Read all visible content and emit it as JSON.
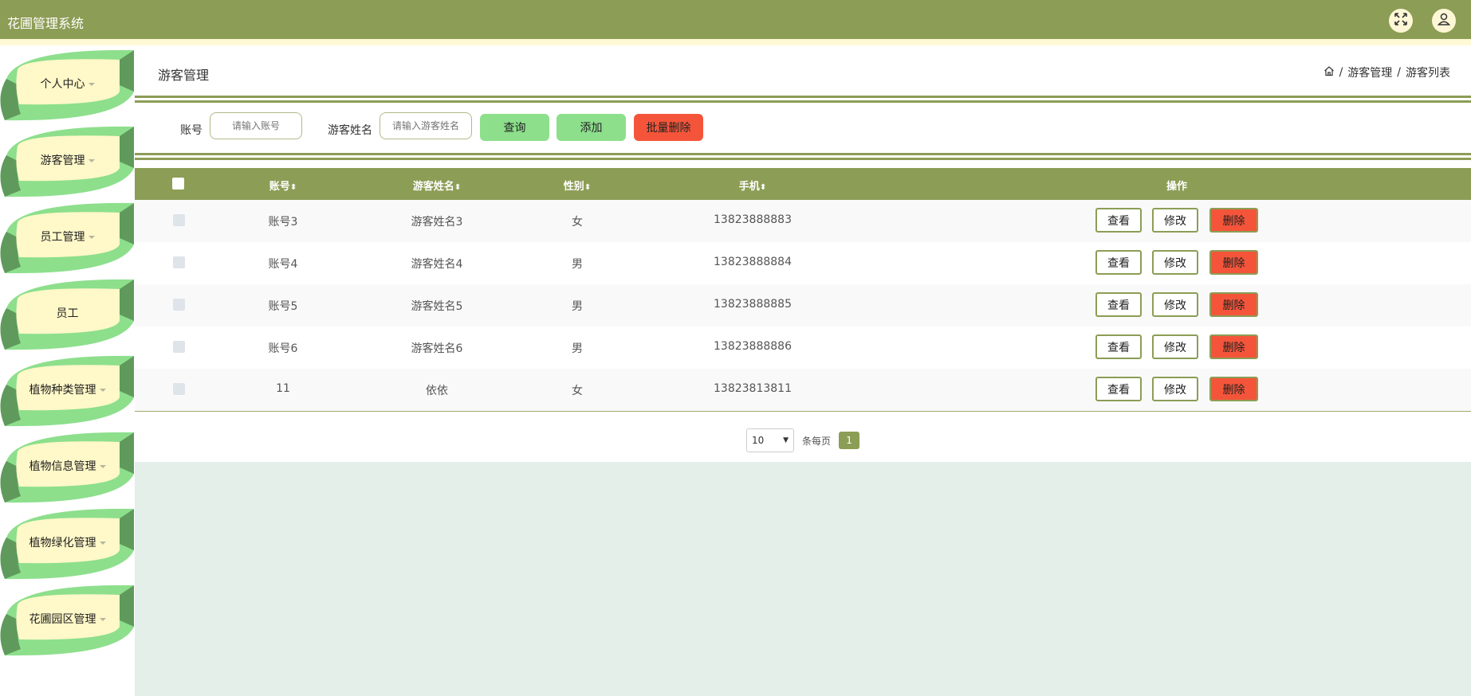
{
  "app": {
    "title": "花圃管理系统"
  },
  "sidebar": {
    "items": [
      {
        "label": "个人中心",
        "has_caret": true
      },
      {
        "label": "游客管理",
        "has_caret": true
      },
      {
        "label": "员工管理",
        "has_caret": true
      },
      {
        "label": "员工",
        "has_caret": false
      },
      {
        "label": "植物种类管理",
        "has_caret": true
      },
      {
        "label": "植物信息管理",
        "has_caret": true
      },
      {
        "label": "植物绿化管理",
        "has_caret": true
      },
      {
        "label": "花圃园区管理",
        "has_caret": true
      }
    ]
  },
  "page": {
    "title": "游客管理",
    "breadcrumb": [
      "游客管理",
      "游客列表"
    ]
  },
  "filters": {
    "account_label": "账号",
    "account_placeholder": "请输入账号",
    "name_label": "游客姓名",
    "name_placeholder": "请输入游客姓名",
    "search_button": "查询",
    "add_button": "添加",
    "batch_delete_button": "批量删除"
  },
  "table": {
    "headers": [
      "账号",
      "游客姓名",
      "性别",
      "手机",
      "操作"
    ],
    "rows": [
      {
        "account": "账号3",
        "name": "游客姓名3",
        "gender": "女",
        "phone": "13823888883"
      },
      {
        "account": "账号4",
        "name": "游客姓名4",
        "gender": "男",
        "phone": "13823888884"
      },
      {
        "account": "账号5",
        "name": "游客姓名5",
        "gender": "男",
        "phone": "13823888885"
      },
      {
        "account": "账号6",
        "name": "游客姓名6",
        "gender": "男",
        "phone": "13823888886"
      },
      {
        "account": "11",
        "name": "依依",
        "gender": "女",
        "phone": "13823813811"
      }
    ],
    "actions": {
      "view": "查看",
      "edit": "修改",
      "delete": "删除"
    }
  },
  "pagination": {
    "page_size": "10",
    "per_page_label": "条每页",
    "current_page": "1"
  },
  "colors": {
    "header": "#8c9d55",
    "leaf_light": "#8ddf8c",
    "leaf_dark": "#5f9a5c",
    "leaf_inner": "#fff8c8",
    "search_btn": "#8ddf8c",
    "delete_btn": "#f4553a",
    "background": "#e4efe9"
  }
}
